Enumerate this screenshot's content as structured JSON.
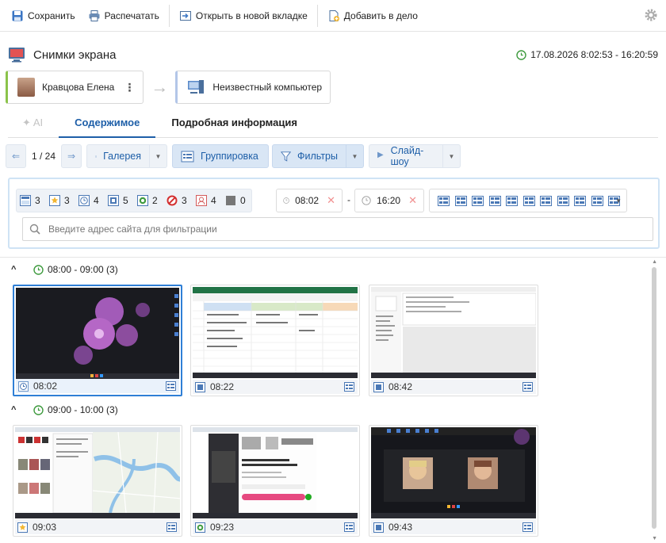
{
  "toolbar": {
    "save": "Сохранить",
    "print": "Распечатать",
    "open_new_tab": "Открыть в новой вкладке",
    "add_to_case": "Добавить в дело"
  },
  "header": {
    "title": "Снимки экрана",
    "time_range": "17.08.2026 8:02:53 - 16:20:59"
  },
  "chips": {
    "user_name": "Кравцова Елена",
    "computer_name": "Неизвестный компьютер"
  },
  "tabs": {
    "ai": "AI",
    "content": "Содержимое",
    "details": "Подробная информация"
  },
  "controls": {
    "pager": "1 / 24",
    "gallery": "Галерея",
    "grouping": "Группировка",
    "filters": "Фильтры",
    "slideshow": "Слайд-шоу"
  },
  "filters": {
    "counts": [
      {
        "icon": "window-icon",
        "count": "3"
      },
      {
        "icon": "star-icon",
        "count": "3"
      },
      {
        "icon": "clock-icon",
        "count": "4"
      },
      {
        "icon": "app-icon",
        "count": "5"
      },
      {
        "icon": "browser-icon",
        "count": "2"
      },
      {
        "icon": "blocked-icon",
        "count": "3"
      },
      {
        "icon": "person-icon",
        "count": "4"
      },
      {
        "icon": "grey-square-icon",
        "count": "0"
      }
    ],
    "time_from": "08:02",
    "time_to": "16:20",
    "search_placeholder": "Введите адрес сайта для фильтрации"
  },
  "groups": [
    {
      "label": "08:00 - 09:00 (3)",
      "items": [
        {
          "time": "08:02",
          "icon": "clock-icon",
          "content": "desktop with flower wallpaper"
        },
        {
          "time": "08:22",
          "icon": "app-icon",
          "content": "spreadsheet"
        },
        {
          "time": "08:42",
          "icon": "app-icon",
          "content": "mail client"
        }
      ]
    },
    {
      "label": "09:00 - 10:00 (3)",
      "items": [
        {
          "time": "09:03",
          "icon": "star-icon",
          "content": "map in browser"
        },
        {
          "time": "09:23",
          "icon": "browser-icon",
          "content": "web page"
        },
        {
          "time": "09:43",
          "icon": "app-icon",
          "content": "video call"
        }
      ]
    }
  ],
  "colors": {
    "accent": "#1e5fa8",
    "green_clock": "#3f9b3f",
    "selected_border": "#2f7fd6"
  }
}
